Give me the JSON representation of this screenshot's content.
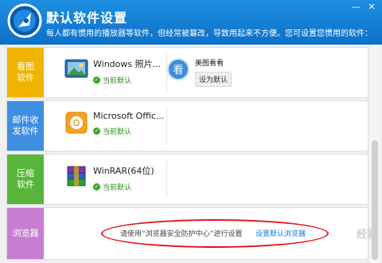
{
  "header": {
    "title": "默认软件设置",
    "subtitle": "每人都有惯用的播放器等软件，但经常被篡改，导致用起来不方便。您可设置您惯用的软件："
  },
  "categories": [
    {
      "label_line1": "看图",
      "label_line2": "软件",
      "color": "#f0b400",
      "apps": [
        {
          "name": "Windows 照片...",
          "status": "当前默认",
          "icon": "photo-viewer-icon"
        },
        {
          "name": "美图看看",
          "button": "设为默认",
          "icon": "meitu-viewer-icon",
          "badge_glyph": "看"
        }
      ]
    },
    {
      "label_line1": "邮件收",
      "label_line2": "发软件",
      "color": "#3e8fe0",
      "apps": [
        {
          "name": "Microsoft Offic...",
          "status": "当前默认",
          "icon": "outlook-icon",
          "badge_glyph": "O"
        }
      ]
    },
    {
      "label_line1": "压缩",
      "label_line2": "软件",
      "color": "#57b63a",
      "apps": [
        {
          "name": "WinRAR(64位)",
          "status": "当前默认",
          "icon": "winrar-icon"
        }
      ]
    },
    {
      "label_line1": "浏览器",
      "label_line2": "",
      "color": "#c77ed1",
      "message": "请使用“浏览器安全防护中心”进行设置",
      "link": "设置默认浏览器"
    }
  ],
  "watermark": "经验"
}
